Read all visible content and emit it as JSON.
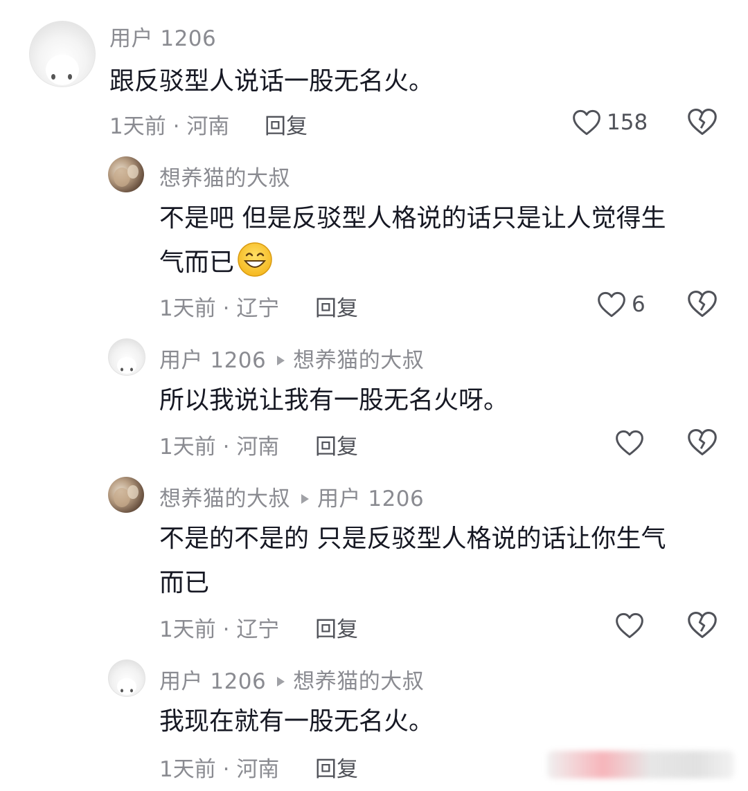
{
  "comments": [
    {
      "user": "用户 1206",
      "reply_to": "",
      "lines": [
        "跟反驳型人说话一股无名火。"
      ],
      "time": "1天前",
      "location": "河南",
      "reply_label": "回复",
      "likes": "158"
    },
    {
      "user": "想养猫的大叔",
      "reply_to": "",
      "lines": [
        "不是吧 但是反驳型人格说的话只是让人觉得生",
        "气而已"
      ],
      "emoji": "grinning-face-emoji",
      "time": "1天前",
      "location": "辽宁",
      "reply_label": "回复",
      "likes": "6"
    },
    {
      "user": "用户 1206",
      "reply_to": "想养猫的大叔",
      "lines": [
        "所以我说让我有一股无名火呀。"
      ],
      "time": "1天前",
      "location": "河南",
      "reply_label": "回复",
      "likes": ""
    },
    {
      "user": "想养猫的大叔",
      "reply_to": "用户 1206",
      "lines": [
        "不是的不是的 只是反驳型人格说的话让你生气",
        "而已"
      ],
      "time": "1天前",
      "location": "辽宁",
      "reply_label": "回复",
      "likes": ""
    },
    {
      "user": "用户 1206",
      "reply_to": "想养猫的大叔",
      "lines": [
        "我现在就有一股无名火。"
      ],
      "time": "1天前",
      "location": "河南",
      "reply_label": "回复",
      "likes": ""
    }
  ],
  "separator": "·",
  "icons": {
    "like": "heart-outline-icon",
    "dislike": "broken-heart-icon",
    "reply_arrow": "triangle-right-icon"
  },
  "colors": {
    "text": "#161823",
    "meta": "#8a8b91",
    "action": "#505259"
  }
}
